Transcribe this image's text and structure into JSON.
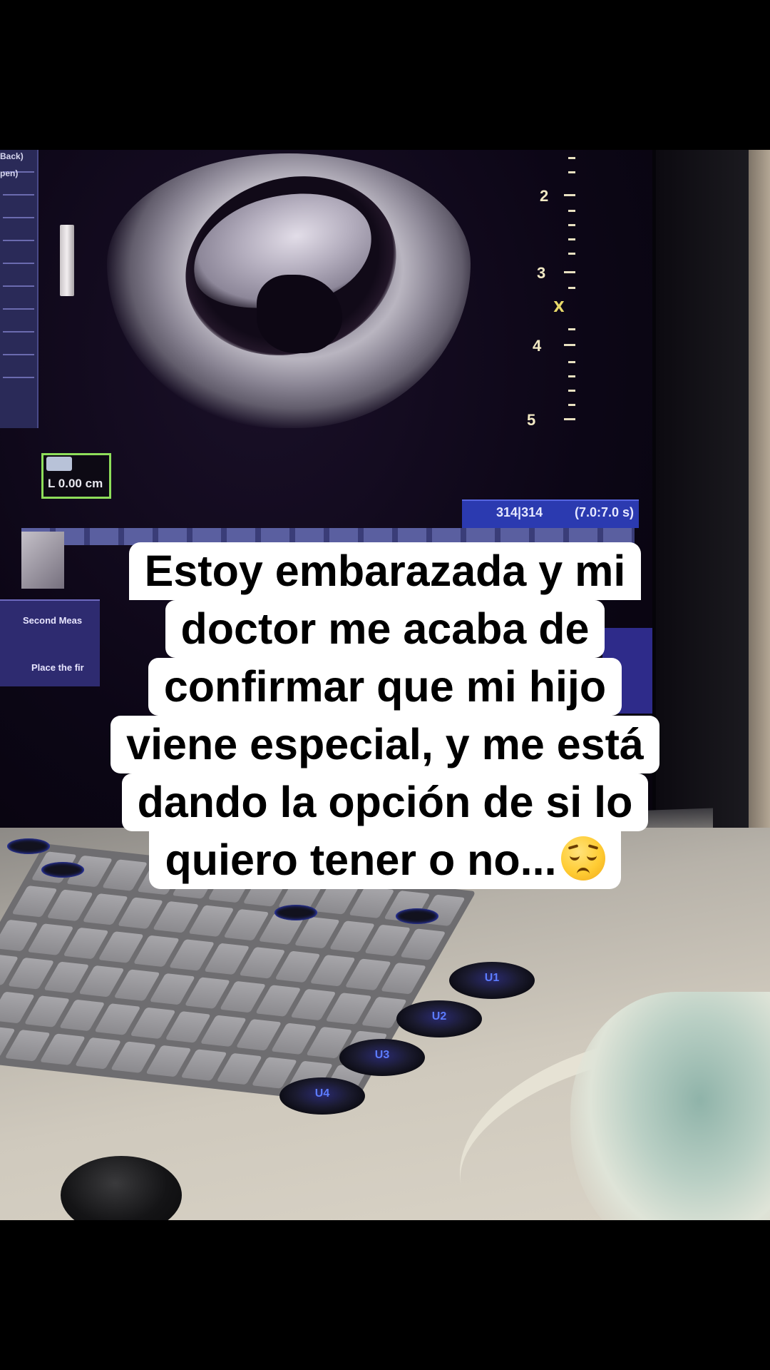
{
  "caption": {
    "lines": [
      "Estoy embarazada y mi",
      "doctor me acaba de",
      "confirmar que mi hijo",
      "viene especial, y me está",
      "dando la opción de si lo",
      "quiero tener o no..."
    ],
    "emoji": "pensive-face-emoji"
  },
  "ultrasound": {
    "depth_labels": [
      "2",
      "3",
      "4",
      "5"
    ],
    "focus_marker": "Ⅹ",
    "measurement": "L 0.00 cm",
    "cine_frame": "314|314",
    "cine_time": "(7.0:7.0 s)",
    "left_panel_labels": [
      "Back)",
      "pen)"
    ],
    "bottom_panel_labels": [
      "Second Meas",
      "Place the fir"
    ]
  },
  "console": {
    "user_buttons": [
      "U1",
      "U2",
      "U3",
      "U4"
    ]
  }
}
